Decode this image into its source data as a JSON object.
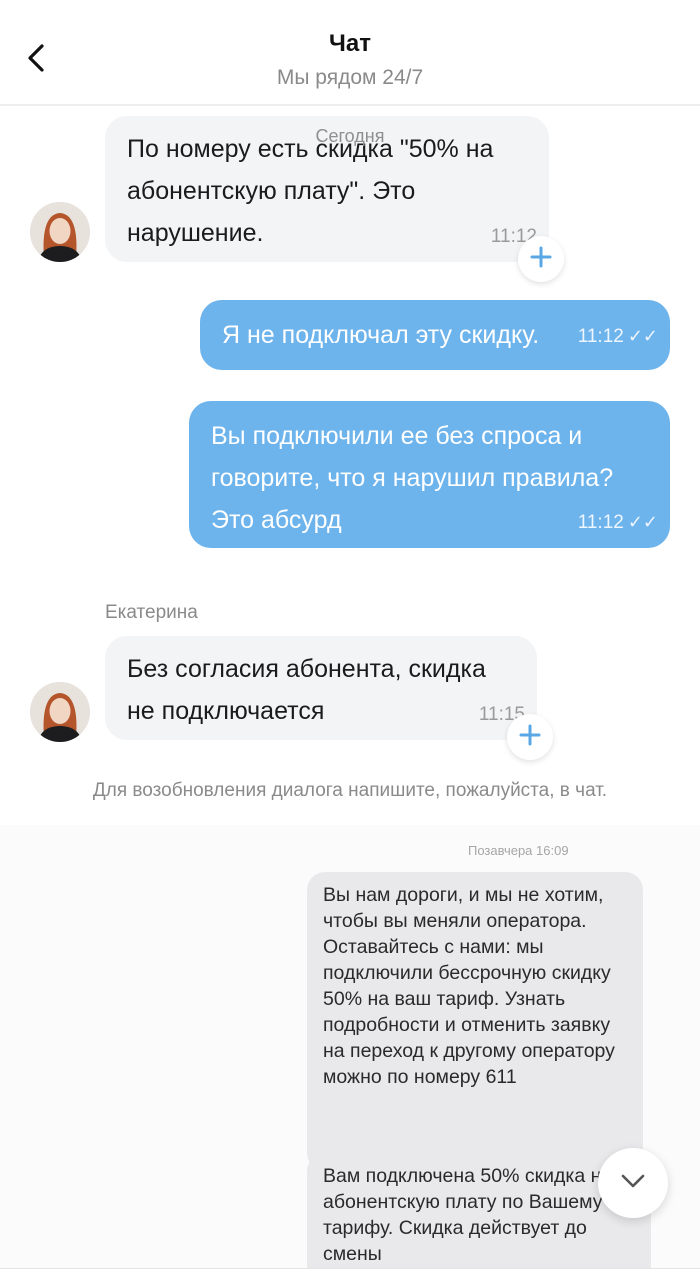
{
  "header": {
    "title": "Чат",
    "subtitle": "Мы рядом 24/7",
    "back_icon": "chevron-left-icon"
  },
  "chat": {
    "date_separator": "Сегодня",
    "messages": [
      {
        "direction": "incoming",
        "text": "По номеру есть скидка \"50% на абонентскую плату\". Это нарушение.",
        "time": "11:12"
      },
      {
        "direction": "outgoing",
        "text": "Я не подключал эту скидку.",
        "time": "11:12",
        "status_icon": "double-check-icon"
      },
      {
        "direction": "outgoing",
        "text": "Вы подключили ее без спроса и говорите, что я нарушил правила? Это абсурд",
        "time": "11:12",
        "status_icon": "double-check-icon"
      },
      {
        "direction": "incoming",
        "sender": "Екатерина",
        "text": "Без согласия абонента, скидка не подключается",
        "time": "11:15"
      }
    ],
    "notice": "Для возобновления диалога напишите, пожалуйста, в чат."
  },
  "attached_screenshot": {
    "timestamp": "Позавчера 16:09",
    "sms": [
      "Вы нам дороги, и мы не хотим, чтобы вы меняли оператора. Оставайтесь с нами: мы подключили бессрочную скидку 50% на ваш тариф. Узнать подробности и отменить заявку на переход к другому оператору можно по номеру 611",
      "Вам подключена 50% скидка на абонентскую плату по Вашему тарифу. Скидка действует до смены"
    ]
  },
  "colors": {
    "outgoing_bubble": "#6db3ec",
    "incoming_bubble": "#f3f4f6",
    "plus_icon": "#5aa7e6",
    "sms_bubble": "#e9e9eb"
  }
}
